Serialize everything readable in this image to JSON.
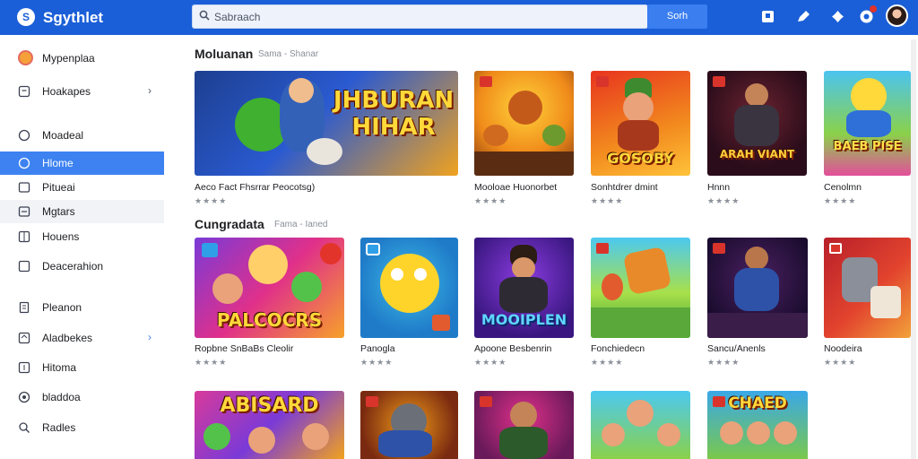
{
  "app": {
    "title": "Sgythlet",
    "logo_glyph": "S"
  },
  "search": {
    "placeholder": "Sabraach",
    "button_label": "Sorh"
  },
  "sidebar": {
    "items": [
      {
        "label": "Mypenplaa",
        "icon": "profile-icon"
      },
      {
        "label": "Hoakapes",
        "icon": "home-icon",
        "chevron": "›"
      },
      {
        "label": "Moadeal",
        "icon": "circle-icon"
      },
      {
        "label": "Hlome",
        "icon": "circle-icon",
        "active": true
      },
      {
        "label": "Pitueai",
        "icon": "square-icon"
      },
      {
        "label": "Mgtars",
        "icon": "square-icon"
      },
      {
        "label": "Houens",
        "icon": "grid-icon"
      },
      {
        "label": "Deacerahion",
        "icon": "square-icon"
      },
      {
        "label": "Pleanon",
        "icon": "doc-icon"
      },
      {
        "label": "Aladbekes",
        "icon": "box-icon",
        "chevron": "›"
      },
      {
        "label": "Hitoma",
        "icon": "list-icon"
      },
      {
        "label": "bladdoa",
        "icon": "ring-icon"
      },
      {
        "label": "Radles",
        "icon": "search-icon"
      }
    ]
  },
  "sections": [
    {
      "title": "Moluanan",
      "subtitle": "Sama - Shanar",
      "cards": [
        {
          "title": "Aeco Fact Fhsrrar Peocotsg)",
          "art_text": "JHBURAN HIHAR",
          "stars": "★★★★"
        },
        {
          "title": "Mooloae Huonorbet",
          "art_text": "",
          "stars": "★★★★"
        },
        {
          "title": "Sonhtdrer dmint",
          "art_text": "GOSOBY",
          "stars": "★★★★"
        },
        {
          "title": "Hnnn",
          "art_text": "ARAH VIANT",
          "stars": "★★★★"
        },
        {
          "title": "Cenolmn",
          "art_text": "BAEB PISE",
          "stars": "★★★★"
        }
      ]
    },
    {
      "title": "Cungradata",
      "subtitle": "Fama - Ianed",
      "cards": [
        {
          "title": "Ropbne SnBaBs Cleolir",
          "art_text": "PALCOCRS",
          "stars": "★★★★"
        },
        {
          "title": "Panogla",
          "art_text": "",
          "stars": "★★★★"
        },
        {
          "title": "Apoone Besbenrin",
          "art_text": "MOOIPLEN",
          "stars": "★★★★"
        },
        {
          "title": "Fonchiedecn",
          "art_text": "",
          "stars": "★★★★"
        },
        {
          "title": "Sancu/Anenls",
          "art_text": "",
          "stars": "★★★★"
        },
        {
          "title": "Noodeira",
          "art_text": "",
          "stars": "★★★★"
        }
      ]
    },
    {
      "title": "",
      "subtitle": "",
      "cards": [
        {
          "title": "",
          "art_text": "ABISARD"
        },
        {
          "title": "",
          "art_text": ""
        },
        {
          "title": "",
          "art_text": ""
        },
        {
          "title": "",
          "art_text": ""
        },
        {
          "title": "",
          "art_text": "CHAED"
        }
      ]
    }
  ],
  "colors": {
    "topbar": "#1a5fd8",
    "accent": "#3d82f0",
    "art_text": "#ffd83a"
  }
}
